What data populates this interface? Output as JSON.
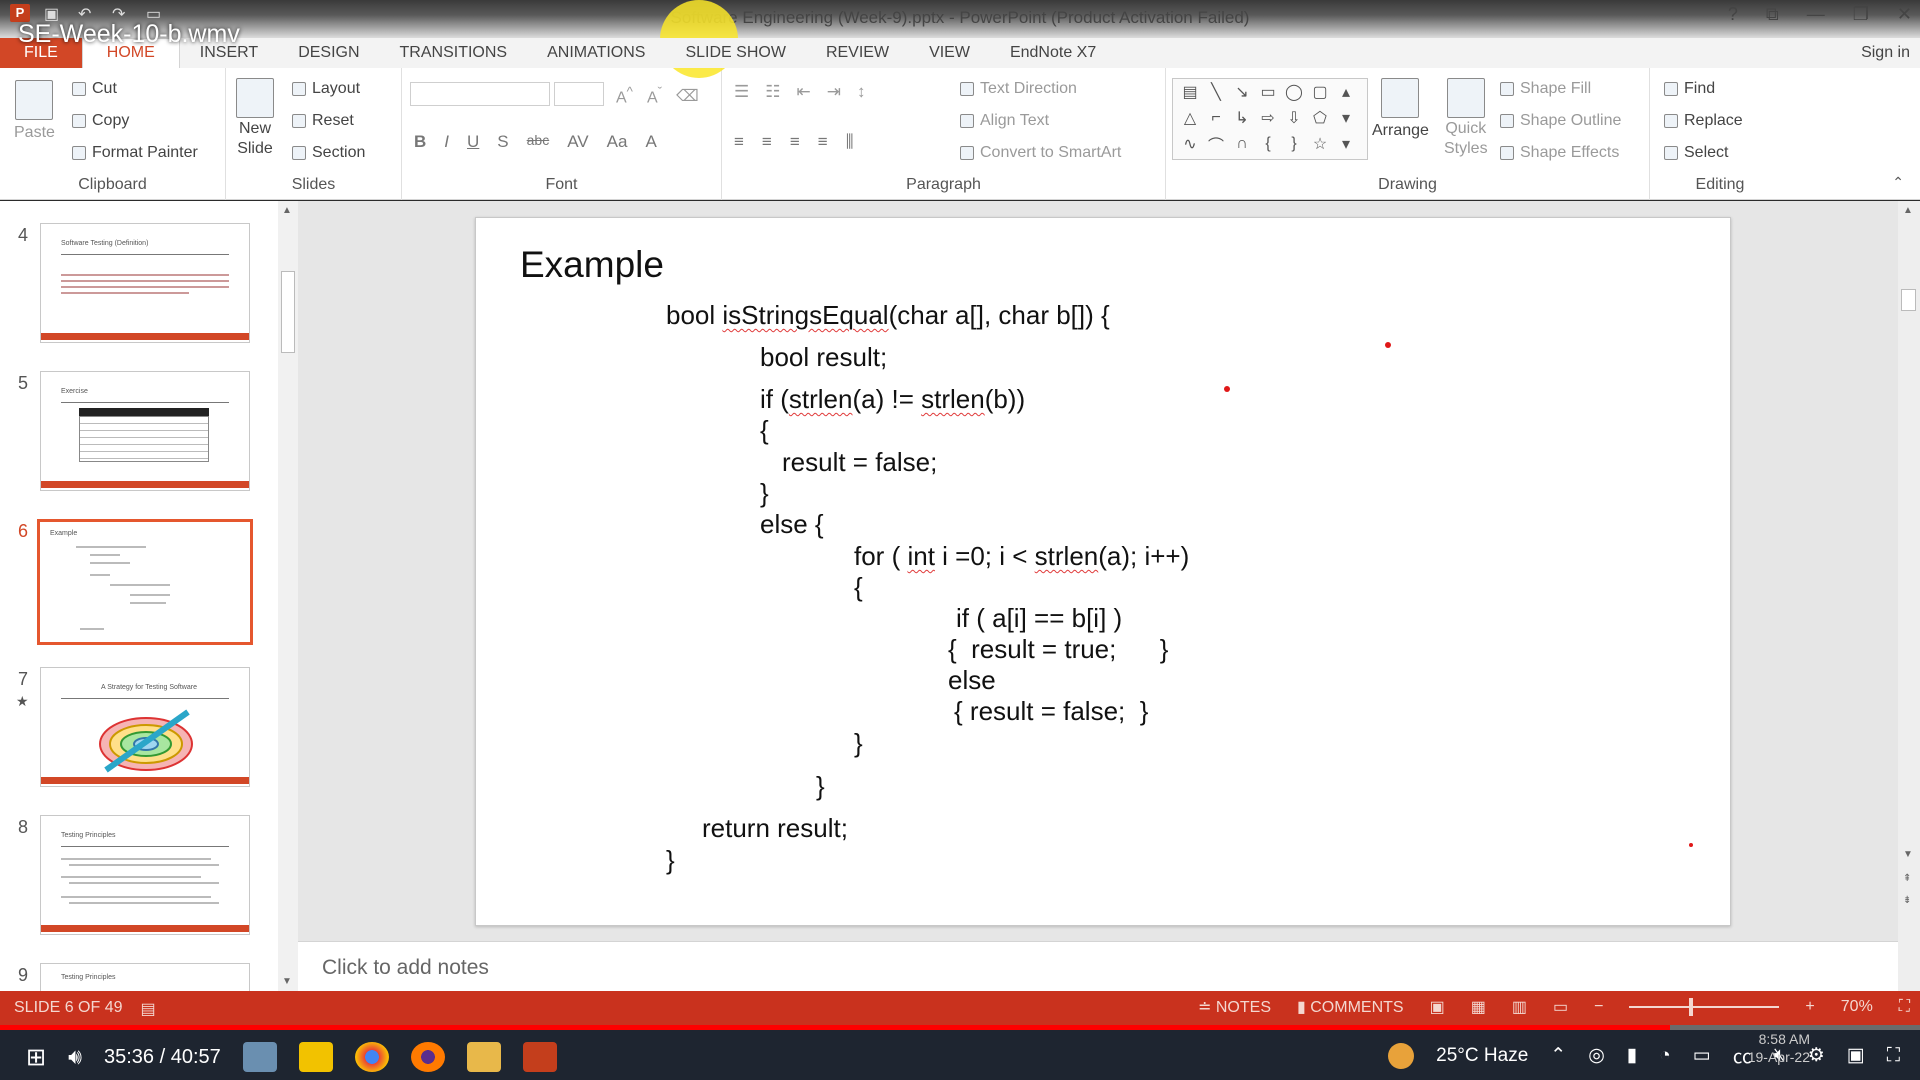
{
  "video": {
    "title": "SE-Week-10-b.wmv",
    "time": "35:36 / 40:57",
    "progress_percent": 87
  },
  "window": {
    "title": "Software Engineering (Week-9).pptx - PowerPoint (Product Activation Failed)",
    "controls": [
      "?",
      "⧉",
      "—",
      "❐",
      "✕"
    ]
  },
  "qat": {
    "logo": "P"
  },
  "tabs": [
    "FILE",
    "HOME",
    "INSERT",
    "DESIGN",
    "TRANSITIONS",
    "ANIMATIONS",
    "SLIDE SHOW",
    "REVIEW",
    "VIEW",
    "EndNote X7"
  ],
  "signin": "Sign in",
  "ribbon": {
    "clipboard": {
      "paste": "Paste",
      "cut": "Cut",
      "copy": "Copy",
      "format_painter": "Format Painter",
      "label": "Clipboard"
    },
    "slides": {
      "new_slide": "New",
      "new_slide2": "Slide",
      "layout": "Layout",
      "reset": "Reset",
      "section": "Section",
      "label": "Slides"
    },
    "font": {
      "label": "Font",
      "bold": "B",
      "italic": "I",
      "underline": "U",
      "shadow": "S",
      "strike": "abc",
      "spacing": "AV",
      "case": "Aa",
      "color": "A"
    },
    "paragraph": {
      "text_direction": "Text Direction",
      "align_text": "Align Text",
      "convert": "Convert to SmartArt",
      "label": "Paragraph"
    },
    "drawing": {
      "arrange": "Arrange",
      "quick_styles": "Quick",
      "quick_styles2": "Styles",
      "shape_fill": "Shape Fill",
      "shape_outline": "Shape Outline",
      "shape_effects": "Shape Effects",
      "label": "Drawing"
    },
    "editing": {
      "find": "Find",
      "replace": "Replace",
      "select": "Select",
      "label": "Editing"
    }
  },
  "thumbnails": [
    {
      "num": "4",
      "title": "Software Testing (Definition)",
      "active": false
    },
    {
      "num": "5",
      "title": "Exercise",
      "active": false
    },
    {
      "num": "6",
      "title": "Example",
      "active": true
    },
    {
      "num": "7",
      "title": "A Strategy for Testing Software",
      "active": false,
      "star": "★"
    },
    {
      "num": "8",
      "title": "Testing Principles",
      "active": false
    },
    {
      "num": "9",
      "title": "Testing Principles",
      "active": false
    }
  ],
  "slide": {
    "title": "Example",
    "lines": {
      "l1a": "bool ",
      "l1b": "isStringsEqual",
      "l1c": "(char a[], char b[]) {",
      "l2": "bool result;",
      "l3a": "if (",
      "l3b": "strlen",
      "l3c": "(a) != ",
      "l3d": "strlen",
      "l3e": "(b))",
      "l4": "{",
      "l5": "result = false;",
      "l6": "}",
      "l7": "else {",
      "l8a": "for ( ",
      "l8b": "int",
      "l8c": " i =0; i < ",
      "l8d": "strlen",
      "l8e": "(a); i++)",
      "l9": "{",
      "l10": "if ( a[i] == b[i] )",
      "l11": "{  result = true;      }",
      "l12": "else",
      "l13": "{ result = false;  }",
      "l14": "}",
      "l15": "}",
      "l16": "return result;",
      "l17": "}"
    }
  },
  "notes_placeholder": "Click to add notes",
  "status": {
    "slide": "SLIDE 6 OF 49",
    "notes": "NOTES",
    "comments": "COMMENTS",
    "zoom": "70%"
  },
  "taskbar": {
    "weather": "25°C  Haze",
    "clock_time": "8:58 AM",
    "clock_date": "19-Apr-22"
  }
}
